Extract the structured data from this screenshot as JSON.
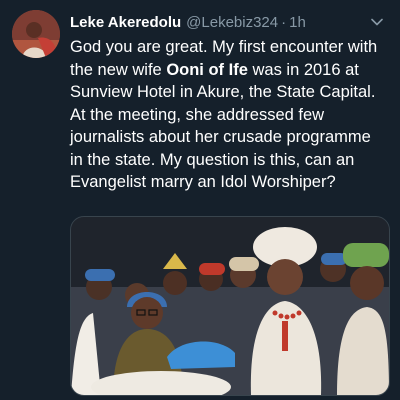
{
  "tweet": {
    "display_name": "Leke Akeredolu",
    "handle": "@Lekebiz324",
    "separator": "·",
    "time": "1h",
    "text_before": "God you are great. My first encounter with the new wife ",
    "text_bold": "Ooni of Ife",
    "text_after": " was in 2016 at Sunview Hotel in Akure, the State Capital. At the meeting, she addressed few journalists about her crusade programme in the state. My question is this, can an Evangelist marry an Idol Worshiper?",
    "icons": {
      "caret": "chevron-down-icon"
    }
  },
  "theme": {
    "background": "#15202b",
    "text": "#ffffff",
    "muted": "#8899a6",
    "border": "#38444d"
  }
}
